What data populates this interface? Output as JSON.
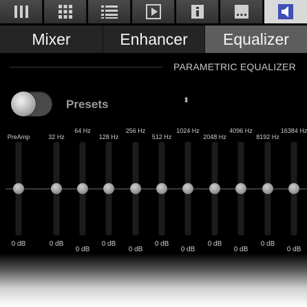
{
  "toolbar": {
    "icons": [
      {
        "name": "library-icon"
      },
      {
        "name": "grid-icon"
      },
      {
        "name": "playlist-icon"
      },
      {
        "name": "play-icon"
      },
      {
        "name": "info-icon"
      },
      {
        "name": "more-icon"
      },
      {
        "name": "speaker-icon",
        "active": true
      }
    ],
    "active_color": "#3f4fb8"
  },
  "tabs": [
    {
      "label": "Mixer",
      "active": false
    },
    {
      "label": "Enhancer",
      "active": false
    },
    {
      "label": "Equalizer",
      "active": true
    }
  ],
  "section": {
    "title": "PARAMETRIC EQUALIZER"
  },
  "controls": {
    "toggle_on": false,
    "presets_label": "Presets",
    "presets_arrow": "⬍"
  },
  "equalizer": {
    "bands": [
      {
        "label": "PreAmp",
        "gain": "0 dB",
        "value_db": 0
      },
      {
        "label": "32 Hz",
        "gain": "0 dB",
        "value_db": 0
      },
      {
        "label": "64 Hz",
        "gain": "0 dB",
        "value_db": 0
      },
      {
        "label": "128 Hz",
        "gain": "0 dB",
        "value_db": 0
      },
      {
        "label": "256 Hz",
        "gain": "0 dB",
        "value_db": 0
      },
      {
        "label": "512 Hz",
        "gain": "0 dB",
        "value_db": 0
      },
      {
        "label": "1024 Hz",
        "gain": "0 dB",
        "value_db": 0
      },
      {
        "label": "2048 Hz",
        "gain": "0 dB",
        "value_db": 0
      },
      {
        "label": "4096 Hz",
        "gain": "0 dB",
        "value_db": 0
      },
      {
        "label": "8192 Hz",
        "gain": "0 dB",
        "value_db": 0
      },
      {
        "label": "16384 Hz",
        "gain": "0 dB",
        "value_db": 0
      }
    ]
  }
}
